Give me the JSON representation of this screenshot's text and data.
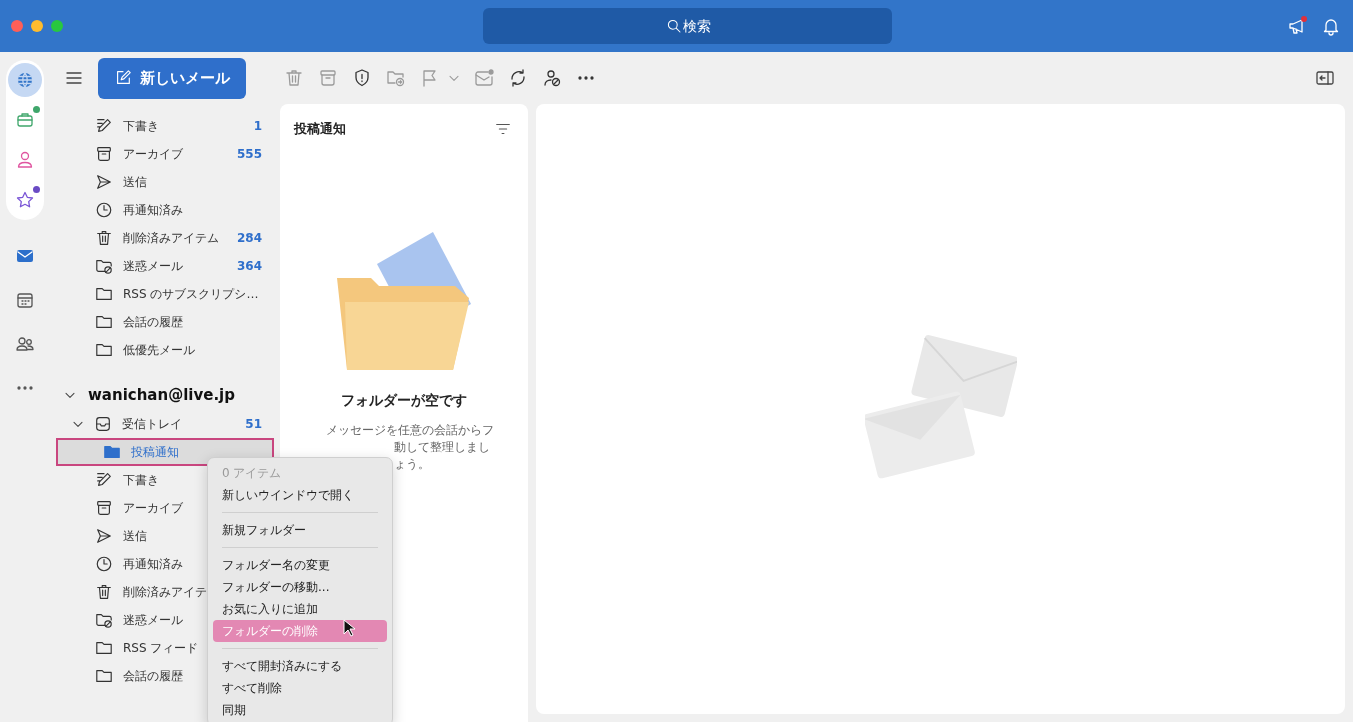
{
  "search": {
    "placeholder": "検索"
  },
  "rail": [
    {
      "kind": "globe",
      "selected": true
    },
    {
      "kind": "briefcase",
      "selected": false,
      "color": "#3fa66b"
    },
    {
      "kind": "person",
      "selected": false
    },
    {
      "kind": "star",
      "selected": false,
      "color": "#6a4bc4"
    }
  ],
  "rail_nav": [
    {
      "kind": "mail",
      "selected": true
    },
    {
      "kind": "calendar",
      "selected": false
    },
    {
      "kind": "people",
      "selected": false
    },
    {
      "kind": "more",
      "selected": false
    }
  ],
  "compose": {
    "label": "新しいメール"
  },
  "toolbar": [
    {
      "kind": "trash",
      "disabled": true
    },
    {
      "kind": "archive",
      "disabled": true
    },
    {
      "kind": "shield",
      "disabled": false
    },
    {
      "kind": "move",
      "disabled": true
    },
    {
      "kind": "flag",
      "disabled": true
    },
    {
      "kind": "caret",
      "disabled": true
    },
    {
      "kind": "unread",
      "disabled": true
    },
    {
      "kind": "sync",
      "disabled": false
    },
    {
      "kind": "block",
      "disabled": false
    },
    {
      "kind": "more",
      "disabled": false
    }
  ],
  "folders": [
    {
      "kind": "draft",
      "label": "下書き",
      "count": "1",
      "selected": false
    },
    {
      "kind": "archive",
      "label": "アーカイブ",
      "count": "555",
      "selected": false
    },
    {
      "kind": "sent",
      "label": "送信",
      "selected": false
    },
    {
      "kind": "clock",
      "label": "再通知済み",
      "selected": false
    },
    {
      "kind": "trash",
      "label": "削除済みアイテム",
      "count": "284",
      "selected": false
    },
    {
      "kind": "junk",
      "label": "迷惑メール",
      "count": "364",
      "selected": false
    },
    {
      "kind": "folder",
      "label": "RSS のサブスクリプシ…",
      "selected": false
    },
    {
      "kind": "folder",
      "label": "会話の履歴",
      "selected": false
    },
    {
      "kind": "folder",
      "label": "低優先メール",
      "selected": false
    }
  ],
  "account": {
    "name": "wanichan@live.jp",
    "expanded": true,
    "folders": [
      {
        "kind": "inbox",
        "label": "受信トレイ",
        "count": "51",
        "expanded": true,
        "selected": false,
        "children": [
          {
            "kind": "folder-filled",
            "label": "投稿通知",
            "selected": true
          }
        ]
      },
      {
        "kind": "draft",
        "label": "下書き",
        "selected": false
      },
      {
        "kind": "archive",
        "label": "アーカイブ",
        "selected": false
      },
      {
        "kind": "sent",
        "label": "送信",
        "selected": false
      },
      {
        "kind": "clock",
        "label": "再通知済み",
        "selected": false
      },
      {
        "kind": "trash",
        "label": "削除済みアイテ",
        "selected": false
      },
      {
        "kind": "junk",
        "label": "迷惑メール",
        "selected": false
      },
      {
        "kind": "folder",
        "label": "RSS フィード",
        "selected": false
      },
      {
        "kind": "folder",
        "label": "会話の履歴",
        "selected": false
      }
    ]
  },
  "list": {
    "title": "投稿通知",
    "empty_title": "フォルダーが空です",
    "empty_lines": [
      "メッセージを任意の会話からフ",
      "動して整理しまし",
      "ょう。"
    ]
  },
  "menu": [
    [
      {
        "label": "0 アイテム",
        "disabled": true,
        "selected": false
      },
      {
        "label": "新しいウインドウで開く",
        "disabled": false,
        "selected": false
      }
    ],
    [
      {
        "label": "新規フォルダー",
        "disabled": false,
        "selected": false
      }
    ],
    [
      {
        "label": "フォルダー名の変更",
        "disabled": false,
        "selected": false
      },
      {
        "label": "フォルダーの移動...",
        "disabled": false,
        "selected": false
      },
      {
        "label": "お気に入りに追加",
        "disabled": false,
        "selected": false
      },
      {
        "label": "フォルダーの削除",
        "disabled": false,
        "selected": true
      }
    ],
    [
      {
        "label": "すべて開封済みにする",
        "disabled": false,
        "selected": false
      },
      {
        "label": "すべて削除",
        "disabled": false,
        "selected": false
      },
      {
        "label": "同期",
        "disabled": false,
        "selected": false
      }
    ]
  ]
}
